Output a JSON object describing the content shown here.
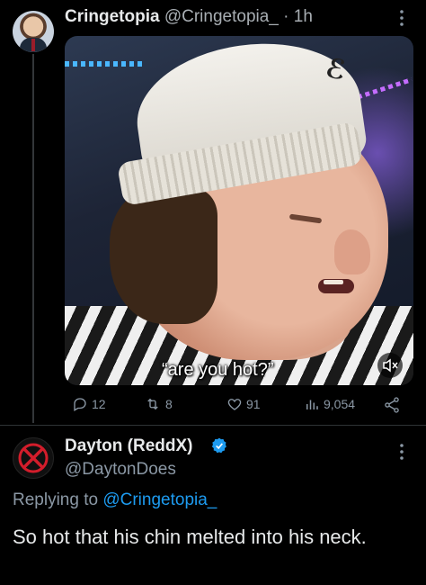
{
  "tweet": {
    "author_name": "Cringetopia",
    "author_handle": "@Cringetopia_",
    "time": "· 1h",
    "more_icon": "more-dots-icon",
    "media": {
      "caption": "“are you hot?”",
      "mute_icon": "volume-mute-icon"
    },
    "stats": {
      "replies": "12",
      "retweets": "8",
      "likes": "91",
      "views": "9,054"
    }
  },
  "reply": {
    "author_name": "Dayton (ReddX)",
    "author_handle": "@DaytonDoes",
    "replying_prefix": "Replying to",
    "replying_to": "@Cringetopia_",
    "text": "So hot that his chin melted into his neck.",
    "verified_color": "#1d9bf0",
    "avatar_color": "#d31d2b"
  },
  "colors": {
    "background": "#000000",
    "text_primary": "#e7e9ea",
    "text_secondary": "#8b98a5",
    "link": "#1d9bf0"
  }
}
